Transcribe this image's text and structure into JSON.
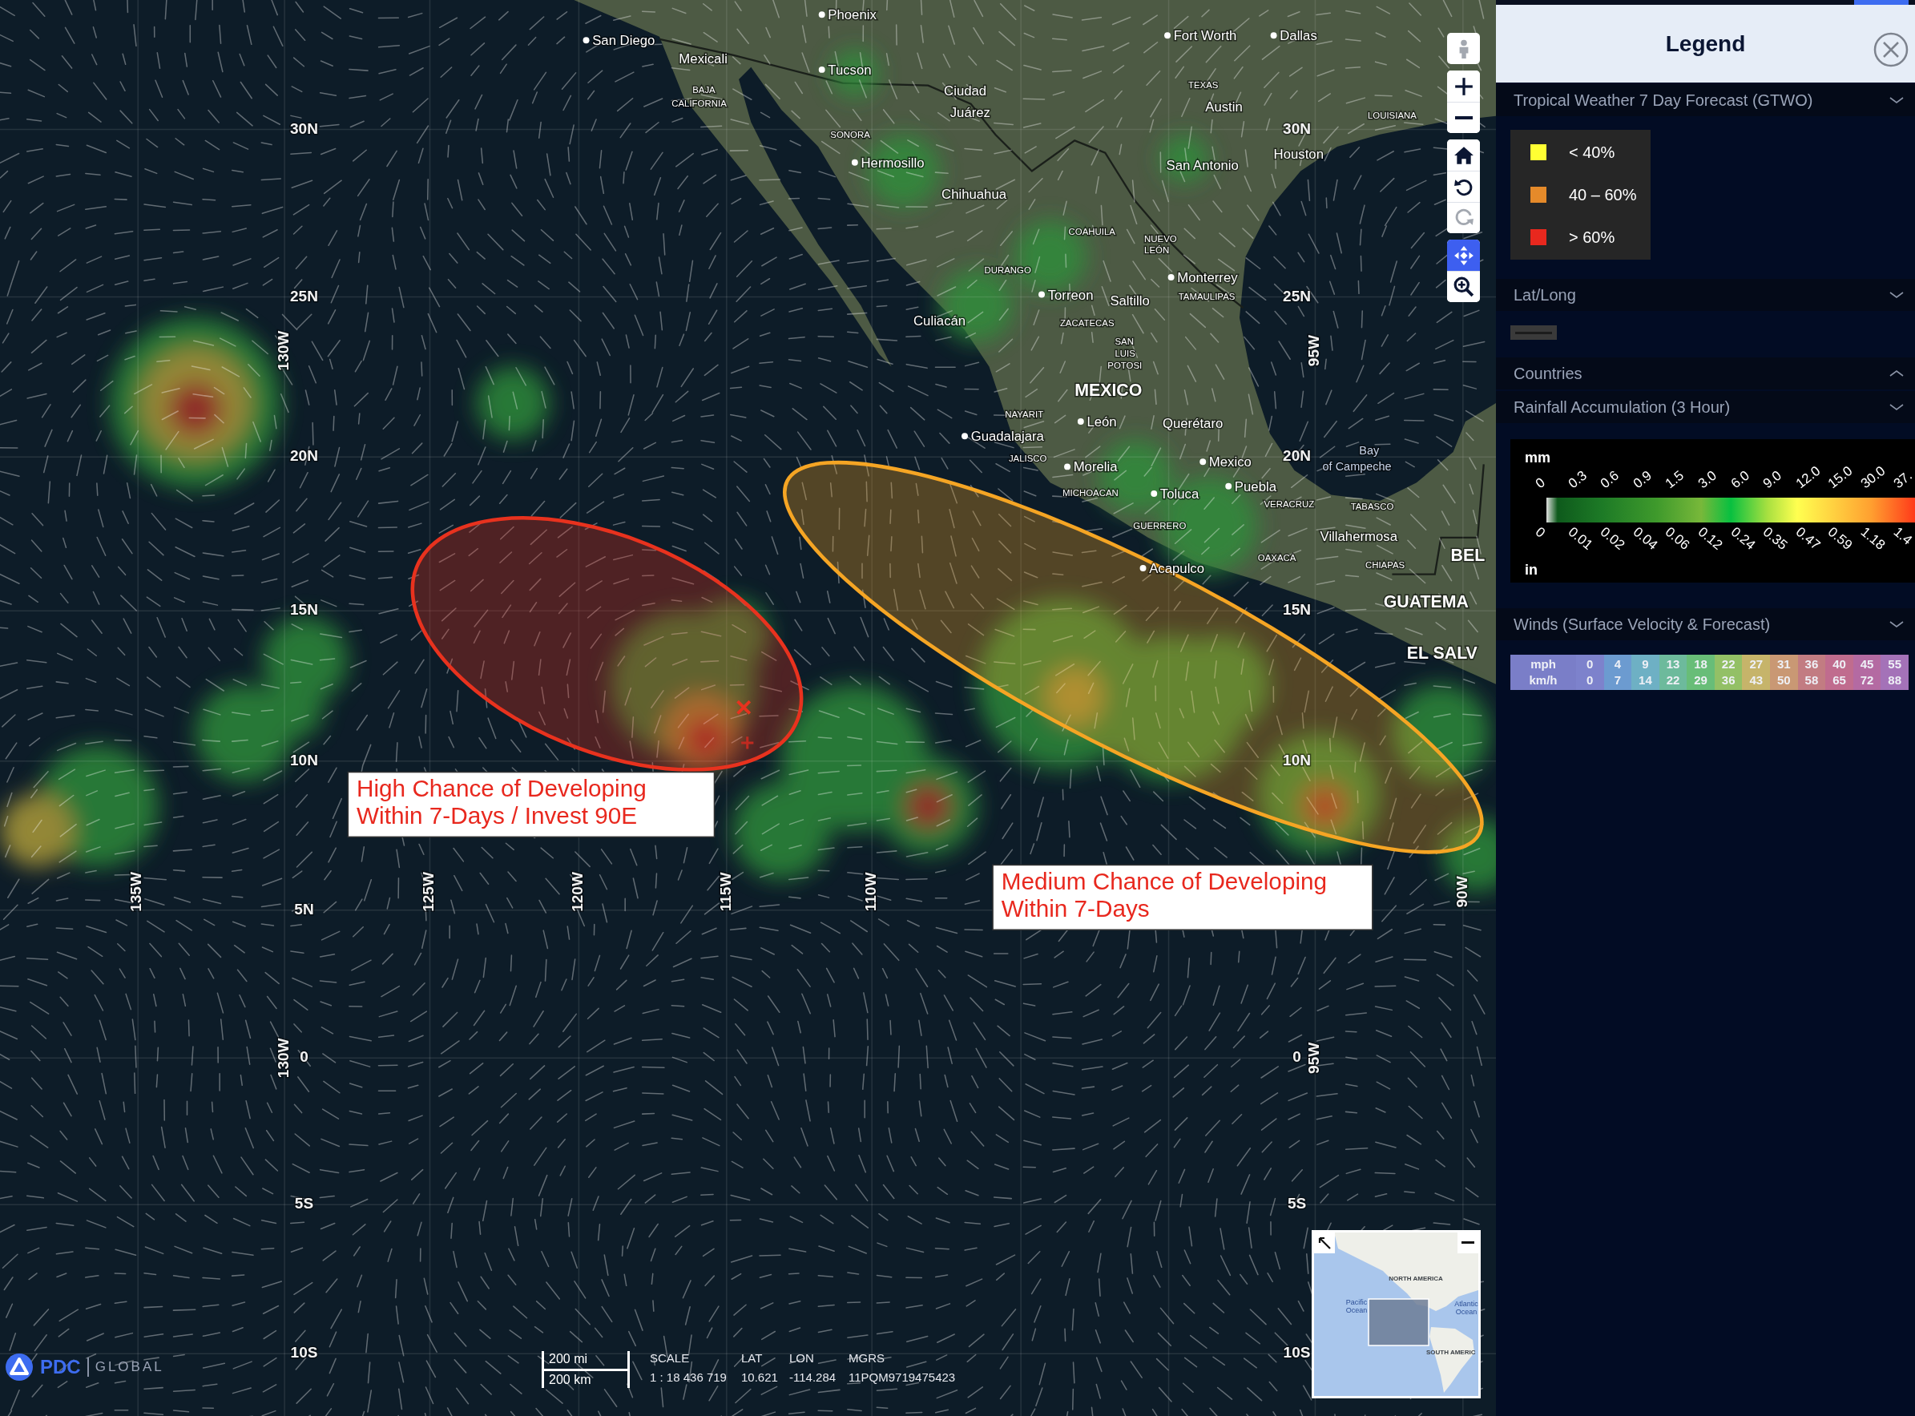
{
  "map": {
    "places": [
      {
        "text": "Phoenix",
        "kind": "city"
      },
      {
        "text": "San Diego",
        "kind": "city"
      },
      {
        "text": "Mexicali",
        "kind": "town"
      },
      {
        "text": "Tucson",
        "kind": "city"
      },
      {
        "text": "BAJA",
        "kind": "state"
      },
      {
        "text": "CALIFORNIA",
        "kind": "state"
      },
      {
        "text": "Fort Worth",
        "kind": "city"
      },
      {
        "text": "Dallas",
        "kind": "city"
      },
      {
        "text": "Ciudad",
        "kind": "town"
      },
      {
        "text": "Juárez",
        "kind": "town"
      },
      {
        "text": "TEXAS",
        "kind": "state"
      },
      {
        "text": "Austin",
        "kind": "town"
      },
      {
        "text": "LOUISIANA",
        "kind": "state"
      },
      {
        "text": "Houston",
        "kind": "town"
      },
      {
        "text": "SONORA",
        "kind": "state"
      },
      {
        "text": "Hermosillo",
        "kind": "city"
      },
      {
        "text": "San Antonio",
        "kind": "town"
      },
      {
        "text": "Chihuahua",
        "kind": "town"
      },
      {
        "text": "COAHUILA",
        "kind": "state"
      },
      {
        "text": "NUEVO",
        "kind": "state"
      },
      {
        "text": "LEÓN",
        "kind": "state"
      },
      {
        "text": "DURANGO",
        "kind": "state"
      },
      {
        "text": "Monterrey",
        "kind": "city"
      },
      {
        "text": "Torreon",
        "kind": "city"
      },
      {
        "text": "Saltillo",
        "kind": "town"
      },
      {
        "text": "TAMAULIPAS",
        "kind": "state"
      },
      {
        "text": "Culiacán",
        "kind": "town"
      },
      {
        "text": "ZACATECAS",
        "kind": "state"
      },
      {
        "text": "SAN",
        "kind": "state"
      },
      {
        "text": "LUIS",
        "kind": "state"
      },
      {
        "text": "POTOSI",
        "kind": "state"
      },
      {
        "text": "MEXICO",
        "kind": "country"
      },
      {
        "text": "NAYARIT",
        "kind": "state"
      },
      {
        "text": "León",
        "kind": "city"
      },
      {
        "text": "Querétaro",
        "kind": "town"
      },
      {
        "text": "Guadalajara",
        "kind": "city"
      },
      {
        "text": "JALISCO",
        "kind": "state"
      },
      {
        "text": "Morelia",
        "kind": "city"
      },
      {
        "text": "Mexico",
        "kind": "city"
      },
      {
        "text": "Puebla",
        "kind": "city"
      },
      {
        "text": "Bay",
        "kind": "water"
      },
      {
        "text": "of Campeche",
        "kind": "water"
      },
      {
        "text": "MICHOACAN",
        "kind": "state"
      },
      {
        "text": "Toluca",
        "kind": "city"
      },
      {
        "text": "VERACRUZ",
        "kind": "state"
      },
      {
        "text": "TABASCO",
        "kind": "state"
      },
      {
        "text": "GUERRERO",
        "kind": "state"
      },
      {
        "text": "Villahermosa",
        "kind": "town"
      },
      {
        "text": "OAXACA",
        "kind": "state"
      },
      {
        "text": "CHIAPAS",
        "kind": "state"
      },
      {
        "text": "Acapulco",
        "kind": "city"
      },
      {
        "text": "BEL",
        "kind": "country"
      },
      {
        "text": "GUATEMA",
        "kind": "country"
      },
      {
        "text": "EL SALV",
        "kind": "country"
      }
    ],
    "grid_labels": [
      {
        "text": "30N",
        "kind": "lat"
      },
      {
        "text": "25N",
        "kind": "lat"
      },
      {
        "text": "20N",
        "kind": "lat"
      },
      {
        "text": "15N",
        "kind": "lat"
      },
      {
        "text": "10N",
        "kind": "lat"
      },
      {
        "text": "5N",
        "kind": "lat"
      },
      {
        "text": "0",
        "kind": "lat"
      },
      {
        "text": "5S",
        "kind": "lat"
      },
      {
        "text": "10S",
        "kind": "lat"
      },
      {
        "text": "30N",
        "kind": "lat"
      },
      {
        "text": "25N",
        "kind": "lat"
      },
      {
        "text": "20N",
        "kind": "lat"
      },
      {
        "text": "15N",
        "kind": "lat"
      },
      {
        "text": "10N",
        "kind": "lat"
      },
      {
        "text": "0",
        "kind": "lat"
      },
      {
        "text": "5S",
        "kind": "lat"
      },
      {
        "text": "10S",
        "kind": "lat"
      },
      {
        "text": "130W",
        "kind": "lon"
      },
      {
        "text": "95W",
        "kind": "lon"
      },
      {
        "text": "135W",
        "kind": "lon"
      },
      {
        "text": "125W",
        "kind": "lon"
      },
      {
        "text": "120W",
        "kind": "lon"
      },
      {
        "text": "115W",
        "kind": "lon"
      },
      {
        "text": "110W",
        "kind": "lon"
      },
      {
        "text": "90W",
        "kind": "lon"
      },
      {
        "text": "130W",
        "kind": "lon"
      },
      {
        "text": "95W",
        "kind": "lon"
      }
    ],
    "outlooks": [
      {
        "kind": "high",
        "color": "#e8321e"
      },
      {
        "kind": "medium",
        "color": "#f5a524"
      }
    ],
    "callouts": [
      {
        "lines": [
          "High Chance of Developing",
          "Within 7-Days / Invest 90E"
        ]
      },
      {
        "lines": [
          "Medium Chance of Developing",
          "Within 7-Days"
        ]
      }
    ],
    "toolbar": [
      [
        {
          "kind": "street-view",
          "selected": false,
          "disabled": true
        }
      ],
      [
        {
          "kind": "zoom-in",
          "selected": false,
          "disabled": false
        },
        {
          "kind": "zoom-out",
          "selected": false,
          "disabled": false
        }
      ],
      [
        {
          "kind": "home",
          "selected": false,
          "disabled": false
        },
        {
          "kind": "rotate-left",
          "selected": false,
          "disabled": false
        },
        {
          "kind": "rotate-right",
          "selected": false,
          "disabled": true
        }
      ],
      [
        {
          "kind": "pan",
          "selected": true,
          "disabled": false
        },
        {
          "kind": "zoom-box",
          "selected": false,
          "disabled": false
        }
      ]
    ],
    "logo": {
      "name": "PDC",
      "tagline": "GLOBAL"
    },
    "scale_bar": {
      "top": "200 mi",
      "bottom": "200 km"
    },
    "readouts": [
      {
        "label": "SCALE",
        "value": "1 : 18 436 719"
      },
      {
        "label": "LAT",
        "value": "10.621"
      },
      {
        "label": "LON",
        "value": "-114.284"
      },
      {
        "label": "MGRS",
        "value": "11PQM9719475423"
      }
    ],
    "overview": {
      "labels": [
        {
          "lines": [
            "NORTH AMERICA"
          ],
          "kind": "continent"
        },
        {
          "lines": [
            "Pacific",
            "Ocean"
          ],
          "kind": "ocean"
        },
        {
          "lines": [
            "Atlantic",
            "Ocean"
          ],
          "kind": "ocean"
        },
        {
          "lines": [
            "SOUTH AMERIC"
          ],
          "kind": "continent"
        }
      ]
    }
  },
  "legend": {
    "title": "Legend",
    "sections": [
      {
        "title": "Tropical Weather 7 Day Forecast (GTWO)",
        "expanded": true,
        "kind": "swatches",
        "items": [
          {
            "label": "< 40%",
            "color": "#ffff33"
          },
          {
            "label": "40 – 60%",
            "color": "#e58a2a"
          },
          {
            "label": "> 60%",
            "color": "#e8281e"
          }
        ]
      },
      {
        "title": "Lat/Long",
        "expanded": true,
        "kind": "line"
      },
      {
        "title": "Countries",
        "expanded": false,
        "kind": "none"
      },
      {
        "title": "Rainfall Accumulation (3 Hour)",
        "expanded": true,
        "kind": "ramp",
        "units": [
          "mm",
          "in"
        ],
        "mm_ticks": [
          "0",
          "0.3",
          "0.6",
          "0.9",
          "1.5",
          "3.0",
          "6.0",
          "9.0",
          "12.0",
          "15.0",
          "30.0",
          "37."
        ],
        "in_ticks": [
          "0",
          "0.01",
          "0.02",
          "0.04",
          "0.06",
          "0.12",
          "0.24",
          "0.35",
          "0.47",
          "0.59",
          "1.18",
          "1.4"
        ]
      },
      {
        "title": "Winds (Surface Velocity & Forecast)",
        "expanded": true,
        "kind": "wind",
        "row_labels": [
          "mph",
          "km/h"
        ],
        "columns": [
          {
            "mph": "0",
            "kmh": "0",
            "color": "#7d82cc"
          },
          {
            "mph": "4",
            "kmh": "7",
            "color": "#6c9bd0"
          },
          {
            "mph": "9",
            "kmh": "14",
            "color": "#6eb0c4"
          },
          {
            "mph": "13",
            "kmh": "22",
            "color": "#6dba9c"
          },
          {
            "mph": "18",
            "kmh": "29",
            "color": "#68bd78"
          },
          {
            "mph": "22",
            "kmh": "36",
            "color": "#93c066"
          },
          {
            "mph": "27",
            "kmh": "43",
            "color": "#c6b46a"
          },
          {
            "mph": "31",
            "kmh": "50",
            "color": "#c99874"
          },
          {
            "mph": "36",
            "kmh": "58",
            "color": "#c27c82"
          },
          {
            "mph": "40",
            "kmh": "65",
            "color": "#c06c8e"
          },
          {
            "mph": "45",
            "kmh": "72",
            "color": "#b46aa2"
          },
          {
            "mph": "55",
            "kmh": "88",
            "color": "#a472b8"
          }
        ]
      }
    ]
  }
}
